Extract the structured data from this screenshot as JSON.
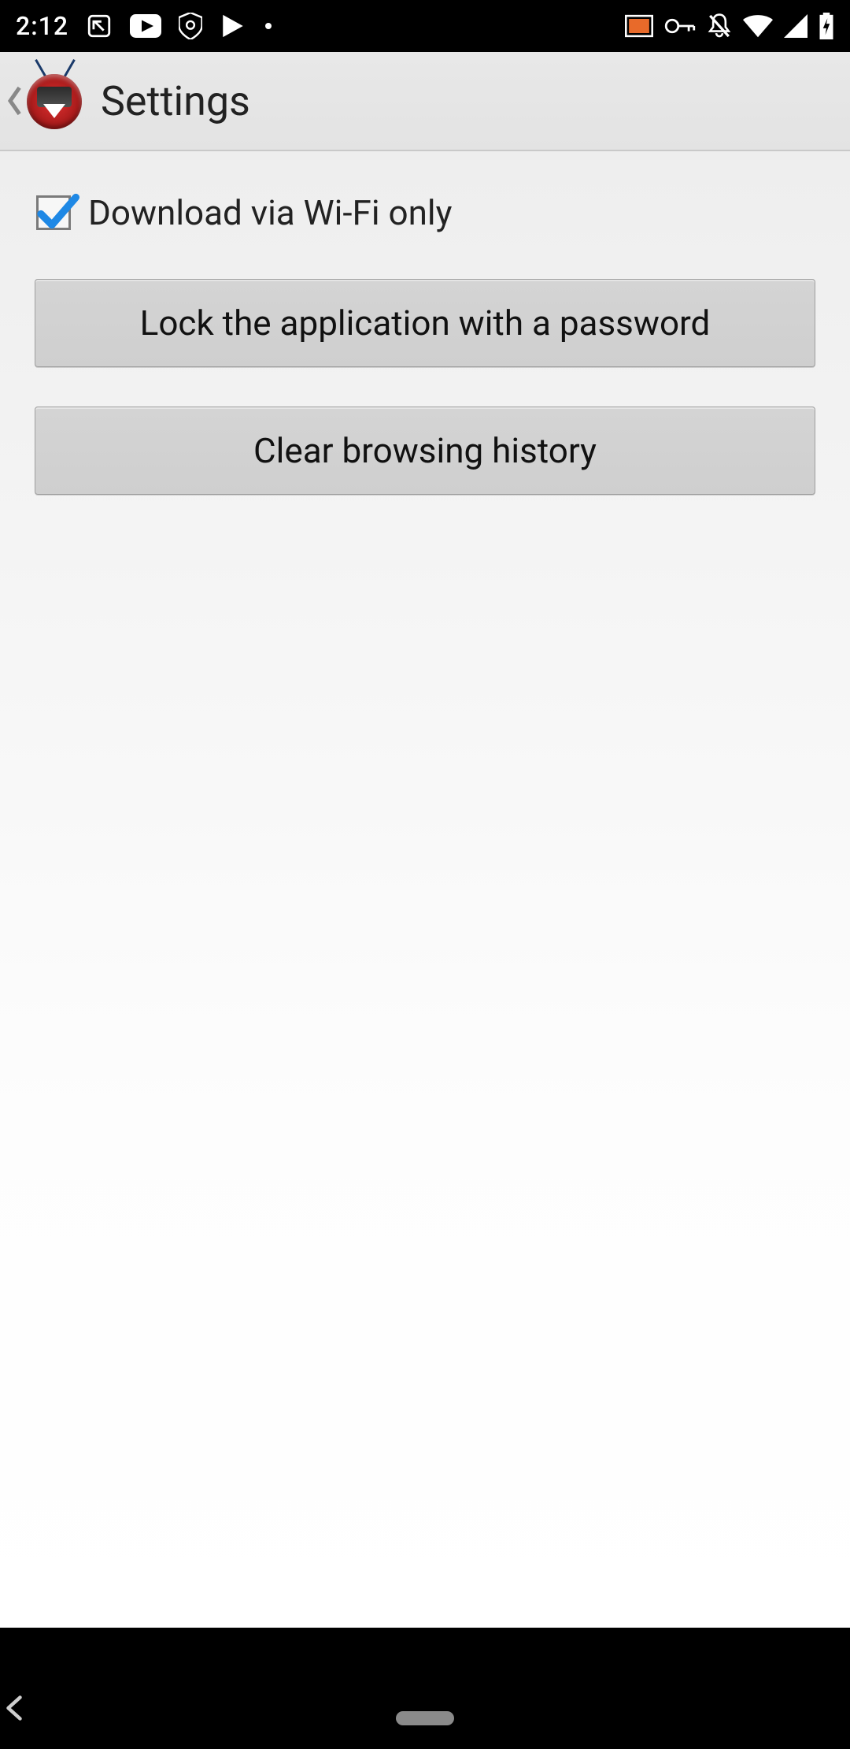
{
  "status": {
    "time": "2:12"
  },
  "header": {
    "title": "Settings"
  },
  "settings": {
    "wifi_only_checked": true,
    "wifi_only_label": "Download via Wi-Fi only",
    "lock_button": "Lock the application with a password",
    "clear_history_button": "Clear browsing history"
  }
}
